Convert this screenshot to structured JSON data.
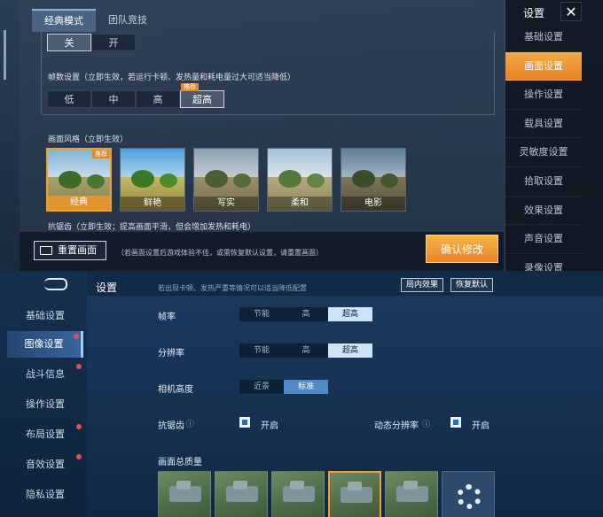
{
  "top": {
    "tabs": [
      {
        "label": "经典模式",
        "active": true
      },
      {
        "label": "团队竞技",
        "active": false
      }
    ],
    "onoff": {
      "options": [
        "关",
        "开"
      ],
      "selected": "关"
    },
    "fps_label": "帧数设置（立即生效，若运行卡顿、发热量和耗电量过大可适当降低）",
    "fps": {
      "options": [
        "低",
        "中",
        "高",
        "超高"
      ],
      "selected": "超高",
      "badge": "推荐"
    },
    "style_label": "画面风格（立即生效）",
    "styles": [
      {
        "name": "经典",
        "selected": true,
        "badge": "推荐"
      },
      {
        "name": "鲜艳",
        "selected": false
      },
      {
        "name": "写实",
        "selected": false
      },
      {
        "name": "柔和",
        "selected": false
      },
      {
        "name": "电影",
        "selected": false
      }
    ],
    "aa_label": "抗锯齿（立即生效；提高画面平滑，但会增加发热和耗电）",
    "reset_label": "重置画面",
    "hint": "（若画面设置后游戏体验不佳，或需恢复默认设置，请重置画面）",
    "confirm_label": "确认修改",
    "side_title": "设置",
    "side_close": "✕",
    "side_items": [
      {
        "label": "基础设置",
        "selected": false
      },
      {
        "label": "画面设置",
        "selected": true
      },
      {
        "label": "操作设置",
        "selected": false
      },
      {
        "label": "载具设置",
        "selected": false
      },
      {
        "label": "灵敏度设置",
        "selected": false
      },
      {
        "label": "拾取设置",
        "selected": false
      },
      {
        "label": "效果设置",
        "selected": false
      },
      {
        "label": "声音设置",
        "selected": false
      },
      {
        "label": "录像设置",
        "selected": false
      }
    ]
  },
  "bottom": {
    "title": "设置",
    "hint": "若出现卡顿、发热严重等情况可以适当降低配置",
    "btn_in_game": "局内效果",
    "btn_restore": "恢复默认",
    "nav": [
      {
        "label": "基础设置",
        "selected": false,
        "dot": false
      },
      {
        "label": "图像设置",
        "selected": true,
        "dot": true
      },
      {
        "label": "战斗信息",
        "selected": false,
        "dot": true
      },
      {
        "label": "操作设置",
        "selected": false,
        "dot": false
      },
      {
        "label": "布局设置",
        "selected": false,
        "dot": true
      },
      {
        "label": "音效设置",
        "selected": false,
        "dot": true
      },
      {
        "label": "隐私设置",
        "selected": false,
        "dot": false
      }
    ],
    "fps_label": "帧率",
    "fps": {
      "options": [
        "节能",
        "高",
        "超高"
      ],
      "selected": "超高"
    },
    "res_label": "分辨率",
    "res": {
      "options": [
        "节能",
        "高",
        "超高"
      ],
      "selected": "超高"
    },
    "cam_label": "相机高度",
    "cam": {
      "options": [
        "近景",
        "标准"
      ],
      "selected": "标准"
    },
    "aa_label": "抗锯齿",
    "aa_value": "开启",
    "dyn_label": "动态分辨率",
    "dyn_value": "开启",
    "quality_label": "画面总质量"
  }
}
